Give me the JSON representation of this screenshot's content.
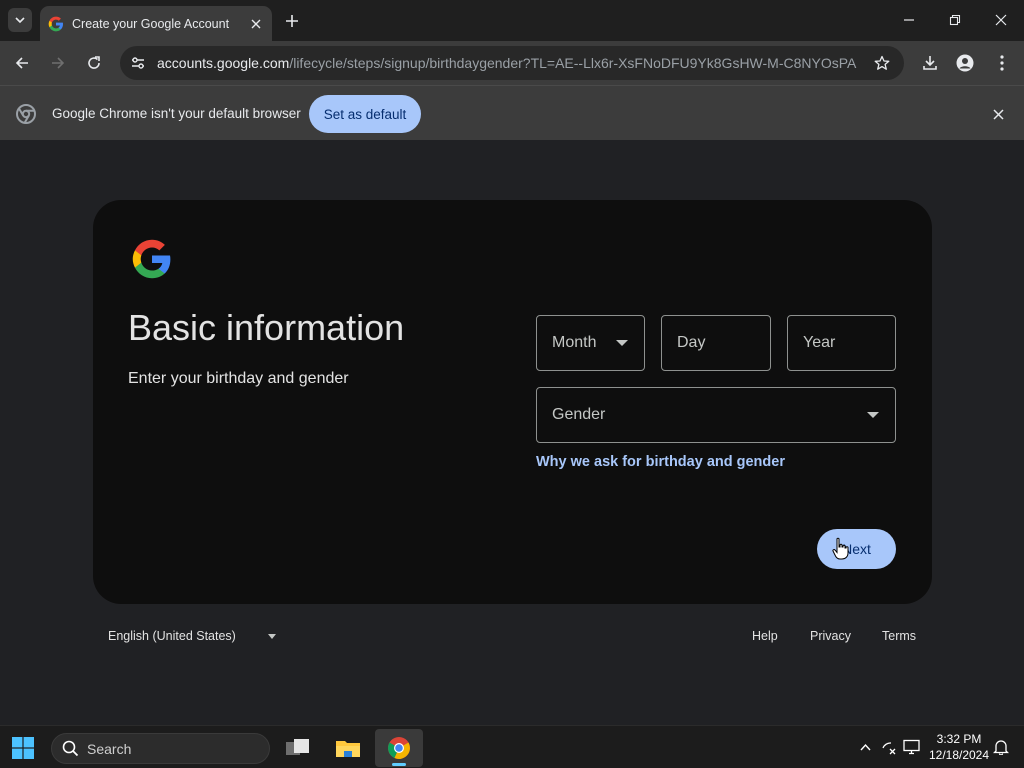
{
  "browser": {
    "tab": {
      "title": "Create your Google Account"
    },
    "url": {
      "host": "accounts.google.com",
      "path": "/lifecycle/steps/signup/birthdaygender?TL=AE--Llx6r-XsFNoDFU9Yk8GsHW-M-C8NYOsPA..."
    },
    "infobar": {
      "message": "Google Chrome isn't your default browser",
      "button_label": "Set as default"
    }
  },
  "signup": {
    "title": "Basic information",
    "subtitle": "Enter your birthday and gender",
    "month_placeholder": "Month",
    "day_placeholder": "Day",
    "year_placeholder": "Year",
    "gender_placeholder": "Gender",
    "why_link": "Why we ask for birthday and gender",
    "next_label": "Next"
  },
  "footer": {
    "language": "English (United States)",
    "links": [
      "Help",
      "Privacy",
      "Terms"
    ]
  },
  "taskbar": {
    "search_label": "Search",
    "time": "3:32 PM",
    "date": "12/18/2024"
  },
  "colors": {
    "accent": "#a8c7fa",
    "card_bg": "#0e0e0e",
    "page_bg": "#202124"
  }
}
